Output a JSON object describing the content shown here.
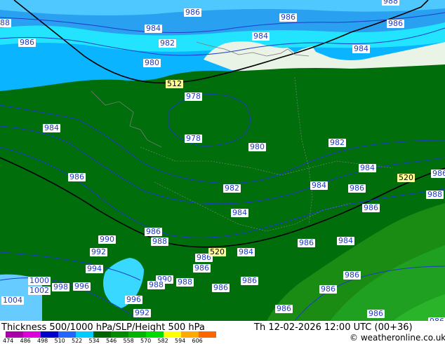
{
  "footer": {
    "title": "Thickness 500/1000 hPa/SLP/Height 500 hPa",
    "datetime": "Th 12-02-2026 12:00 UTC (00+36)",
    "copyright": "© weatheronline.co.uk"
  },
  "legend": {
    "ticks": [
      "474",
      "486",
      "498",
      "510",
      "522",
      "534",
      "546",
      "558",
      "570",
      "582",
      "594",
      "606"
    ],
    "colors": [
      "#aa00aa",
      "#dd00dd",
      "#0000cc",
      "#2266ff",
      "#00ccff",
      "#006400",
      "#008c00",
      "#00b400",
      "#00dc00",
      "#ffff00",
      "#ffaa00",
      "#ff6400"
    ]
  },
  "slp_labels": [
    {
      "text": "986"
    },
    {
      "text": "986"
    },
    {
      "text": "986"
    },
    {
      "text": "988"
    },
    {
      "text": "88"
    },
    {
      "text": "984"
    },
    {
      "text": "984"
    },
    {
      "text": "986"
    },
    {
      "text": "982"
    },
    {
      "text": "984"
    },
    {
      "text": "980"
    },
    {
      "text": "978"
    },
    {
      "text": "984"
    },
    {
      "text": "978"
    },
    {
      "text": "980"
    },
    {
      "text": "982"
    },
    {
      "text": "984"
    },
    {
      "text": "986"
    },
    {
      "text": "982"
    },
    {
      "text": "984"
    },
    {
      "text": "986"
    },
    {
      "text": "986"
    },
    {
      "text": "988"
    },
    {
      "text": "984"
    },
    {
      "text": "986"
    },
    {
      "text": "986"
    },
    {
      "text": "990"
    },
    {
      "text": "988"
    },
    {
      "text": "992"
    },
    {
      "text": "986"
    },
    {
      "text": "984"
    },
    {
      "text": "986"
    },
    {
      "text": "984"
    },
    {
      "text": "994"
    },
    {
      "text": "986"
    },
    {
      "text": "1000"
    },
    {
      "text": "1002"
    },
    {
      "text": "998"
    },
    {
      "text": "996"
    },
    {
      "text": "990"
    },
    {
      "text": "988"
    },
    {
      "text": "988"
    },
    {
      "text": "986"
    },
    {
      "text": "986"
    },
    {
      "text": "986"
    },
    {
      "text": "986"
    },
    {
      "text": "1004"
    },
    {
      "text": "996"
    },
    {
      "text": "992"
    },
    {
      "text": "986"
    },
    {
      "text": "986"
    },
    {
      "text": "986"
    }
  ],
  "thickness_labels": [
    {
      "text": "512"
    },
    {
      "text": "520"
    },
    {
      "text": "520"
    }
  ]
}
